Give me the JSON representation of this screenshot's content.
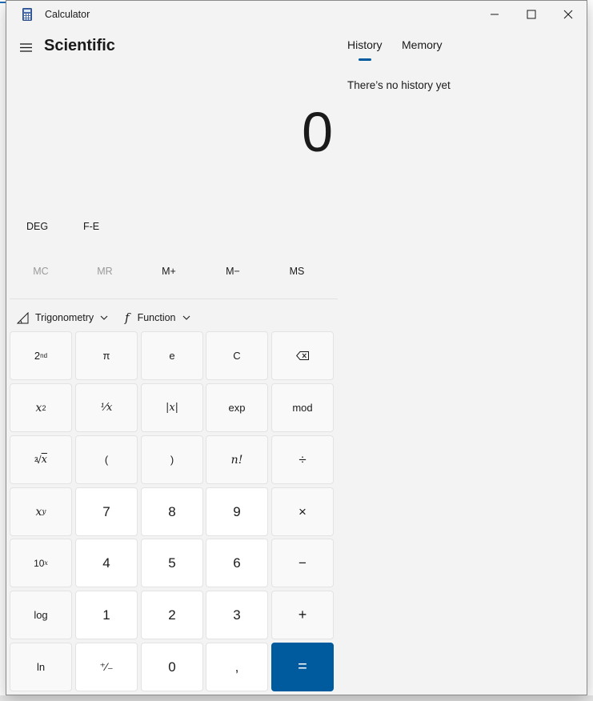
{
  "window": {
    "title": "Calculator",
    "minimize_glyph": "—",
    "maximize_glyph": "☐",
    "close_glyph": "✕"
  },
  "header": {
    "mode": "Scientific"
  },
  "display": {
    "value": "0"
  },
  "angle_row": {
    "deg": "DEG",
    "fe": "F-E"
  },
  "memory_row": {
    "mc": "MC",
    "mr": "MR",
    "mplus": "M+",
    "mminus": "M−",
    "ms": "MS"
  },
  "dropdowns": {
    "trig": "Trigonometry",
    "func": "Function"
  },
  "keys": {
    "second": "2",
    "second_sup": "nd",
    "pi": "π",
    "e": "e",
    "clear": "C",
    "backspace": "⌫",
    "square_base": "x",
    "square_sup": "2",
    "reciprocal": "¹⁄x",
    "abs": "|x|",
    "exp": "exp",
    "mod": "mod",
    "sqrt_idx": "2",
    "sqrt_sym": "√",
    "sqrt_x": "x",
    "lparen": "(",
    "rparen": ")",
    "factorial": "n!",
    "divide": "÷",
    "pow_base": "x",
    "pow_sup": "y",
    "seven": "7",
    "eight": "8",
    "nine": "9",
    "multiply": "×",
    "ten_base": "10",
    "ten_sup": "x",
    "four": "4",
    "five": "5",
    "six": "6",
    "minus": "−",
    "log": "log",
    "one": "1",
    "two": "2",
    "three": "3",
    "plus": "+",
    "ln": "ln",
    "negate": "⁺⁄₋",
    "zero": "0",
    "decimal": ",",
    "equals": "="
  },
  "side_panel": {
    "tabs": [
      "History",
      "Memory"
    ],
    "active_tab": "History",
    "empty_message": "There’s no history yet"
  },
  "colors": {
    "accent": "#005a9e",
    "window_bg": "#f3f3f3",
    "num_key_bg": "#ffffff",
    "fn_key_bg": "#f9f9f9"
  }
}
